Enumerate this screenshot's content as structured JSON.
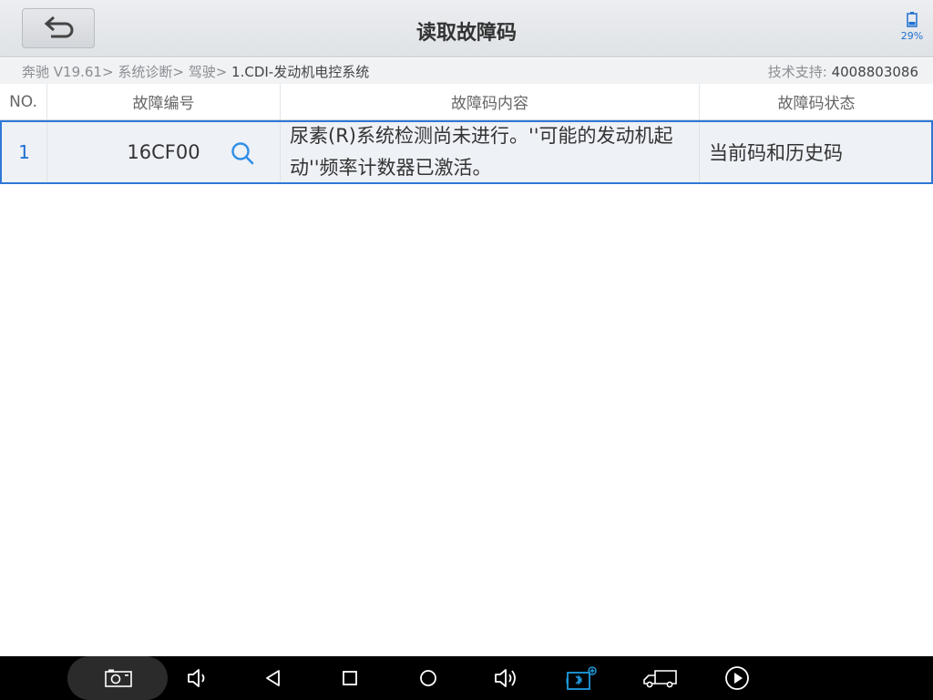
{
  "header": {
    "title": "读取故障码",
    "battery_percent": "29%"
  },
  "breadcrumb": {
    "items": [
      "奔驰 V19.61>",
      "系统诊断>",
      "驾驶>",
      "1.CDI-发动机电控系统"
    ],
    "support_label": "技术支持:",
    "support_number": "4008803086"
  },
  "table": {
    "columns": [
      "NO.",
      "故障编号",
      "故障码内容",
      "故障码状态"
    ],
    "rows": [
      {
        "no": "1",
        "code": "16CF00",
        "content": "尿素(R)系统检测尚未进行。''可能的发动机起动''频率计数器已激活。",
        "status": "当前码和历史码"
      }
    ]
  },
  "navbar": {
    "icons": [
      "screenshot-icon",
      "volume-down-icon",
      "back-icon",
      "recents-icon",
      "home-icon",
      "volume-up-icon",
      "bluetooth-vci-icon",
      "truck-icon",
      "play-icon"
    ],
    "accent": "#1e9be0"
  },
  "colors": {
    "accent": "#1e6fd0",
    "selection_border": "#2f78d6"
  }
}
